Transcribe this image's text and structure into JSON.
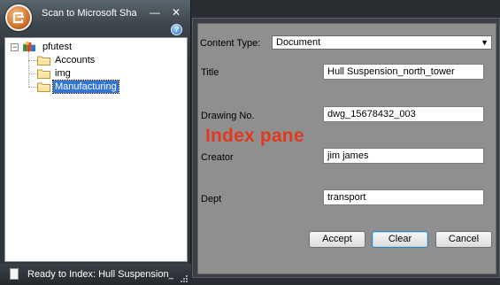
{
  "window": {
    "title": "Scan to Microsoft Shar...",
    "minimize_label": "—",
    "close_label": "✕",
    "help_label": "?"
  },
  "tree": {
    "root": {
      "label": "pfutest"
    },
    "children": [
      {
        "label": "Accounts"
      },
      {
        "label": "img"
      },
      {
        "label": "Manufacturing",
        "selected": true
      }
    ]
  },
  "status": {
    "text": "Ready to Index: Hull Suspension_..."
  },
  "index_pane": {
    "caption": "Index pane",
    "content_type": {
      "label": "Content Type:",
      "value": "Document"
    },
    "fields": [
      {
        "label": "Title",
        "value": "Hull Suspension_north_tower"
      },
      {
        "label": "Drawing No.",
        "value": "dwg_15678432_003"
      },
      {
        "label": "Creator",
        "value": "jim james"
      },
      {
        "label": "Dept",
        "value": "transport"
      }
    ],
    "buttons": {
      "accept": "Accept",
      "clear": "Clear",
      "cancel": "Cancel"
    }
  },
  "colors": {
    "caption": "#e0391d",
    "selection": "#3375d6",
    "pane_background": "#8f8f8f"
  }
}
